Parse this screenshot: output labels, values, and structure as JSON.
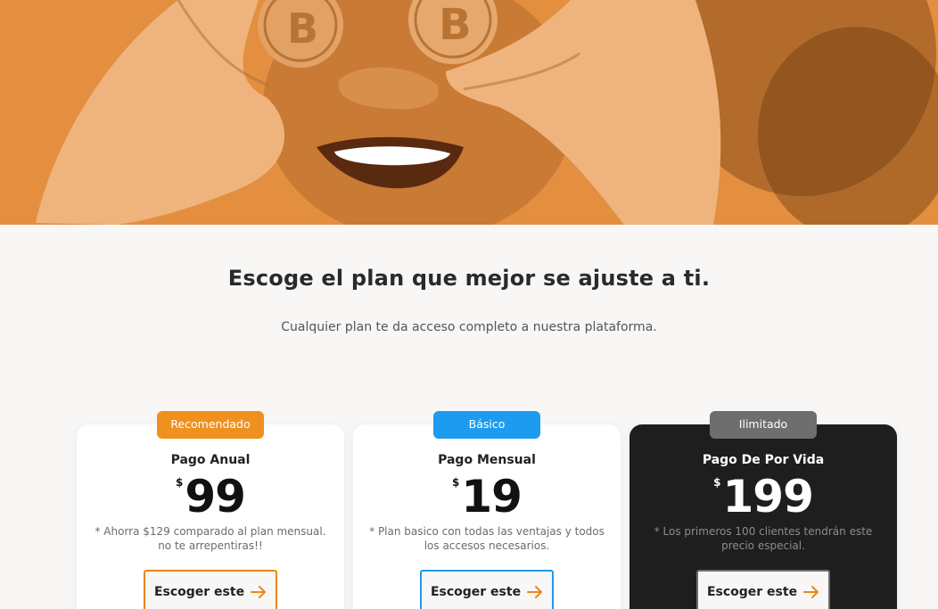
{
  "headline": "Escoge el plan que mejor se ajuste a ti.",
  "subheadline": "Cualquier plan te da acceso completo a nuestra plataforma.",
  "colors": {
    "hero_bg": "#e48f3f",
    "badge_orange": "#f0901f",
    "badge_blue": "#1d9bf0",
    "badge_gray": "#6e6e6e",
    "dark_card": "#1e1e1e",
    "arrow": "#e8861a"
  },
  "plans": [
    {
      "badge": "Recomendado",
      "name": "Pago Anual",
      "currency": "$",
      "price": "99",
      "note": "* Ahorra $129 comparado al plan mensual. no te arrepentiras!!",
      "cta": "Escoger este",
      "cta_icon": "arrow-right-icon"
    },
    {
      "badge": "Básico",
      "name": "Pago Mensual",
      "currency": "$",
      "price": "19",
      "note": "* Plan basico con todas las ventajas y todos los accesos necesarios.",
      "cta": "Escoger este",
      "cta_icon": "arrow-right-icon"
    },
    {
      "badge": "Ilimitado",
      "name": "Pago De Por Vida",
      "currency": "$",
      "price": "199",
      "note": "* Los primeros 100 clientes tendrán este precio especial.",
      "cta": "Escoger este",
      "cta_icon": "arrow-right-icon"
    }
  ]
}
